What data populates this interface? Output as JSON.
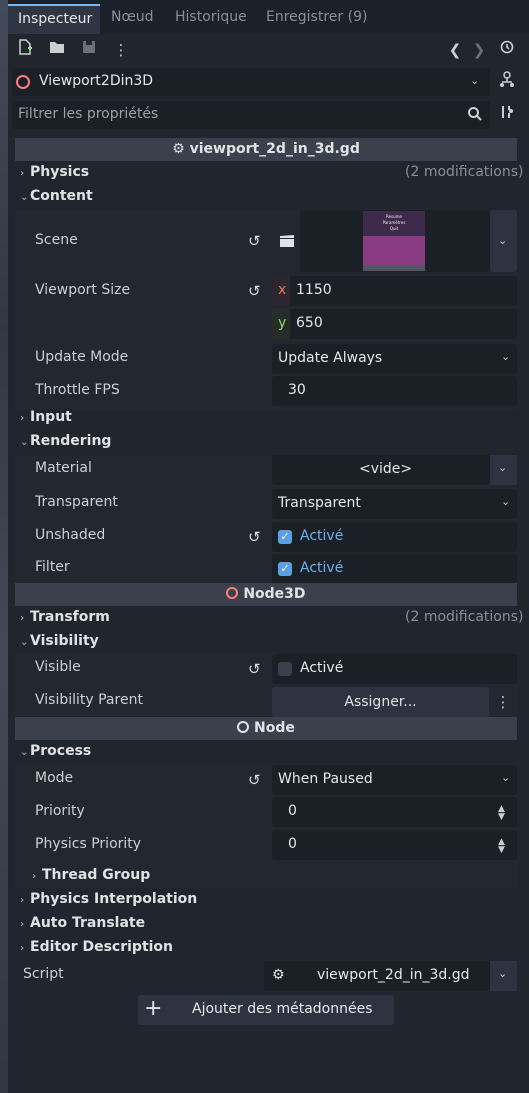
{
  "tabs": [
    {
      "label": "Inspecteur",
      "active": true
    },
    {
      "label": "Nœud",
      "active": false
    },
    {
      "label": "Historique",
      "active": false
    },
    {
      "label": "Enregistrer (9)",
      "active": false
    }
  ],
  "object": {
    "name": "Viewport2Din3D"
  },
  "filter": {
    "placeholder": "Filtrer les propriétés"
  },
  "script_header": "viewport_2d_in_3d.gd",
  "sections": {
    "physics": {
      "label": "Physics",
      "mods": "(2 modifications)"
    },
    "content": {
      "label": "Content"
    },
    "input": {
      "label": "Input"
    },
    "rendering": {
      "label": "Rendering"
    },
    "transform": {
      "label": "Transform",
      "mods": "(2 modifications)"
    },
    "visibility": {
      "label": "Visibility"
    },
    "process": {
      "label": "Process"
    },
    "thread_group": {
      "label": "Thread Group"
    },
    "physics_interpolation": {
      "label": "Physics Interpolation"
    },
    "auto_translate": {
      "label": "Auto Translate"
    },
    "editor_description": {
      "label": "Editor Description"
    }
  },
  "props": {
    "scene": {
      "label": "Scene",
      "preview_items": [
        "Resume",
        "Paramètres",
        "Quit"
      ]
    },
    "viewport_size": {
      "label": "Viewport Size",
      "x_label": "x",
      "x": "1150",
      "y_label": "y",
      "y": "650"
    },
    "update_mode": {
      "label": "Update Mode",
      "value": "Update Always"
    },
    "throttle_fps": {
      "label": "Throttle FPS",
      "value": "30"
    },
    "material": {
      "label": "Material",
      "value": "<vide>"
    },
    "transparent": {
      "label": "Transparent",
      "value": "Transparent"
    },
    "unshaded": {
      "label": "Unshaded",
      "value": "Activé"
    },
    "filter": {
      "label": "Filter",
      "value": "Activé"
    },
    "visible": {
      "label": "Visible",
      "value": "Activé"
    },
    "visibility_parent": {
      "label": "Visibility Parent",
      "value": "Assigner..."
    },
    "mode": {
      "label": "Mode",
      "value": "When Paused"
    },
    "priority": {
      "label": "Priority",
      "value": "0"
    },
    "physics_priority": {
      "label": "Physics Priority",
      "value": "0"
    },
    "script": {
      "label": "Script",
      "value": "viewport_2d_in_3d.gd"
    }
  },
  "class_headers": {
    "node3d": "Node3D",
    "node": "Node"
  },
  "add_metadata": "Ajouter des métadonnées",
  "colors": {
    "accent": "#70bafa",
    "node3d_icon": "#fc7f7f",
    "scene_preview": "#8a3c82",
    "checkbox_on": "#5b9fe6"
  }
}
